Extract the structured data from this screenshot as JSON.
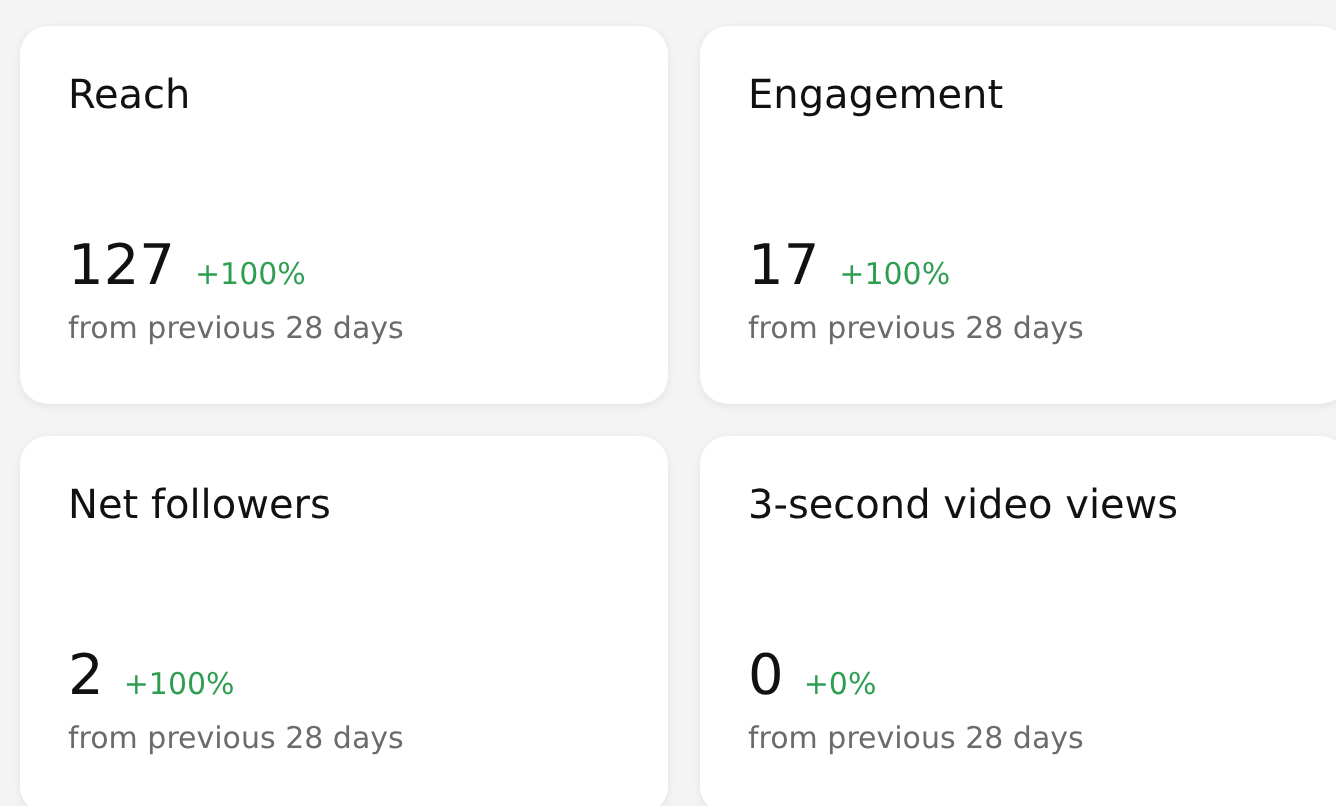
{
  "cards": [
    {
      "title": "Reach",
      "value": "127",
      "change": "+100%",
      "caption": "from previous 28 days"
    },
    {
      "title": "Engagement",
      "value": "17",
      "change": "+100%",
      "caption": "from previous 28 days"
    },
    {
      "title": "Net followers",
      "value": "2",
      "change": "+100%",
      "caption": "from previous 28 days"
    },
    {
      "title": "3-second video views",
      "value": "0",
      "change": "+0%",
      "caption": "from previous 28 days"
    }
  ]
}
